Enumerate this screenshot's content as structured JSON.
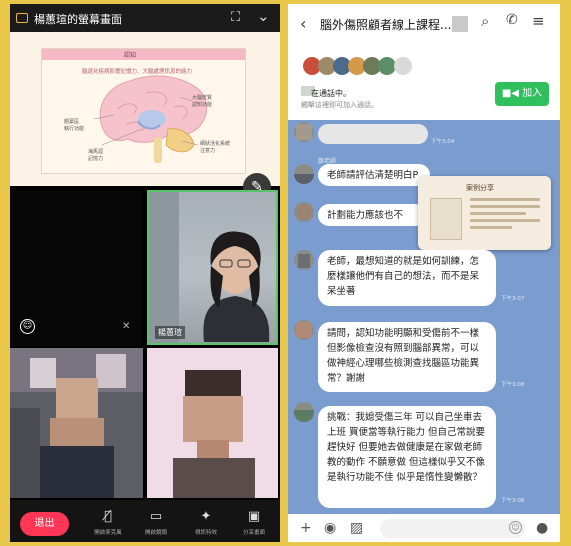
{
  "left": {
    "share_title": "楊蕙瑄的螢幕畫面",
    "slide": {
      "title": "認知",
      "subtitle": "腦退化疾病影響記憶力、大腦處理訊息的能力",
      "labels": {
        "frontal": "額葉區\n執行功能",
        "cortex": "大腦皮質\n認知功能",
        "hippocampus": "海馬迴\n記憶力",
        "limbic": "網狀活化系統\n注意力"
      }
    },
    "speaker_name": "楊蕙瑄",
    "toolbar": [
      {
        "label": "退出",
        "icon": "leave"
      },
      {
        "label": "開啟麥克風",
        "icon": "mic-off-icon"
      },
      {
        "label": "開啟鏡頭",
        "icon": "camera-off-icon"
      },
      {
        "label": "視訊特效",
        "icon": "effects-icon"
      },
      {
        "label": "分享畫面",
        "icon": "screen-share-icon"
      }
    ]
  },
  "right": {
    "header_title": "腦外傷照顧者線上課程...(",
    "call_status": "在通話中。",
    "call_sub": "觸擊這裡即可加入通話。",
    "join_label": "加入",
    "card_title": "案例分享",
    "messages": [
      {
        "sender": "",
        "text": "",
        "time": "下午3:04"
      },
      {
        "sender": "鄭老師",
        "text": "老師請評估清楚明白P",
        "time": ""
      },
      {
        "sender": "",
        "text": "計劃能力應該也不",
        "time": ""
      },
      {
        "sender": "",
        "text": "老師，最想知道的就是如何訓練，怎麼樣讓他們有自己的想法，而不是呆呆坐著",
        "time": "下午3:07"
      },
      {
        "sender": "",
        "text": "請問，認知功能明顯和受傷前不一樣但影像檢查沒有照到腦部異常，可以做神經心理哪些檢測查找腦區功能異常？謝謝",
        "time": "下午3:08"
      },
      {
        "sender": "",
        "text": "挑戰：我媳受傷三年 可以自己坐車去上班 買便當等執行能力 但自己常說要趕快好 但要她去做健康是在家做老師教的動作 不願意做 但這樣似乎又不像是執行功能不佳 似乎是惰性變懶散？",
        "time": "下午3:08"
      }
    ]
  },
  "colors": {
    "leave": "#ff3655",
    "join": "#2fc05d",
    "chat_bg": "#7b9ccf",
    "speaker_border": "#58c46c"
  }
}
